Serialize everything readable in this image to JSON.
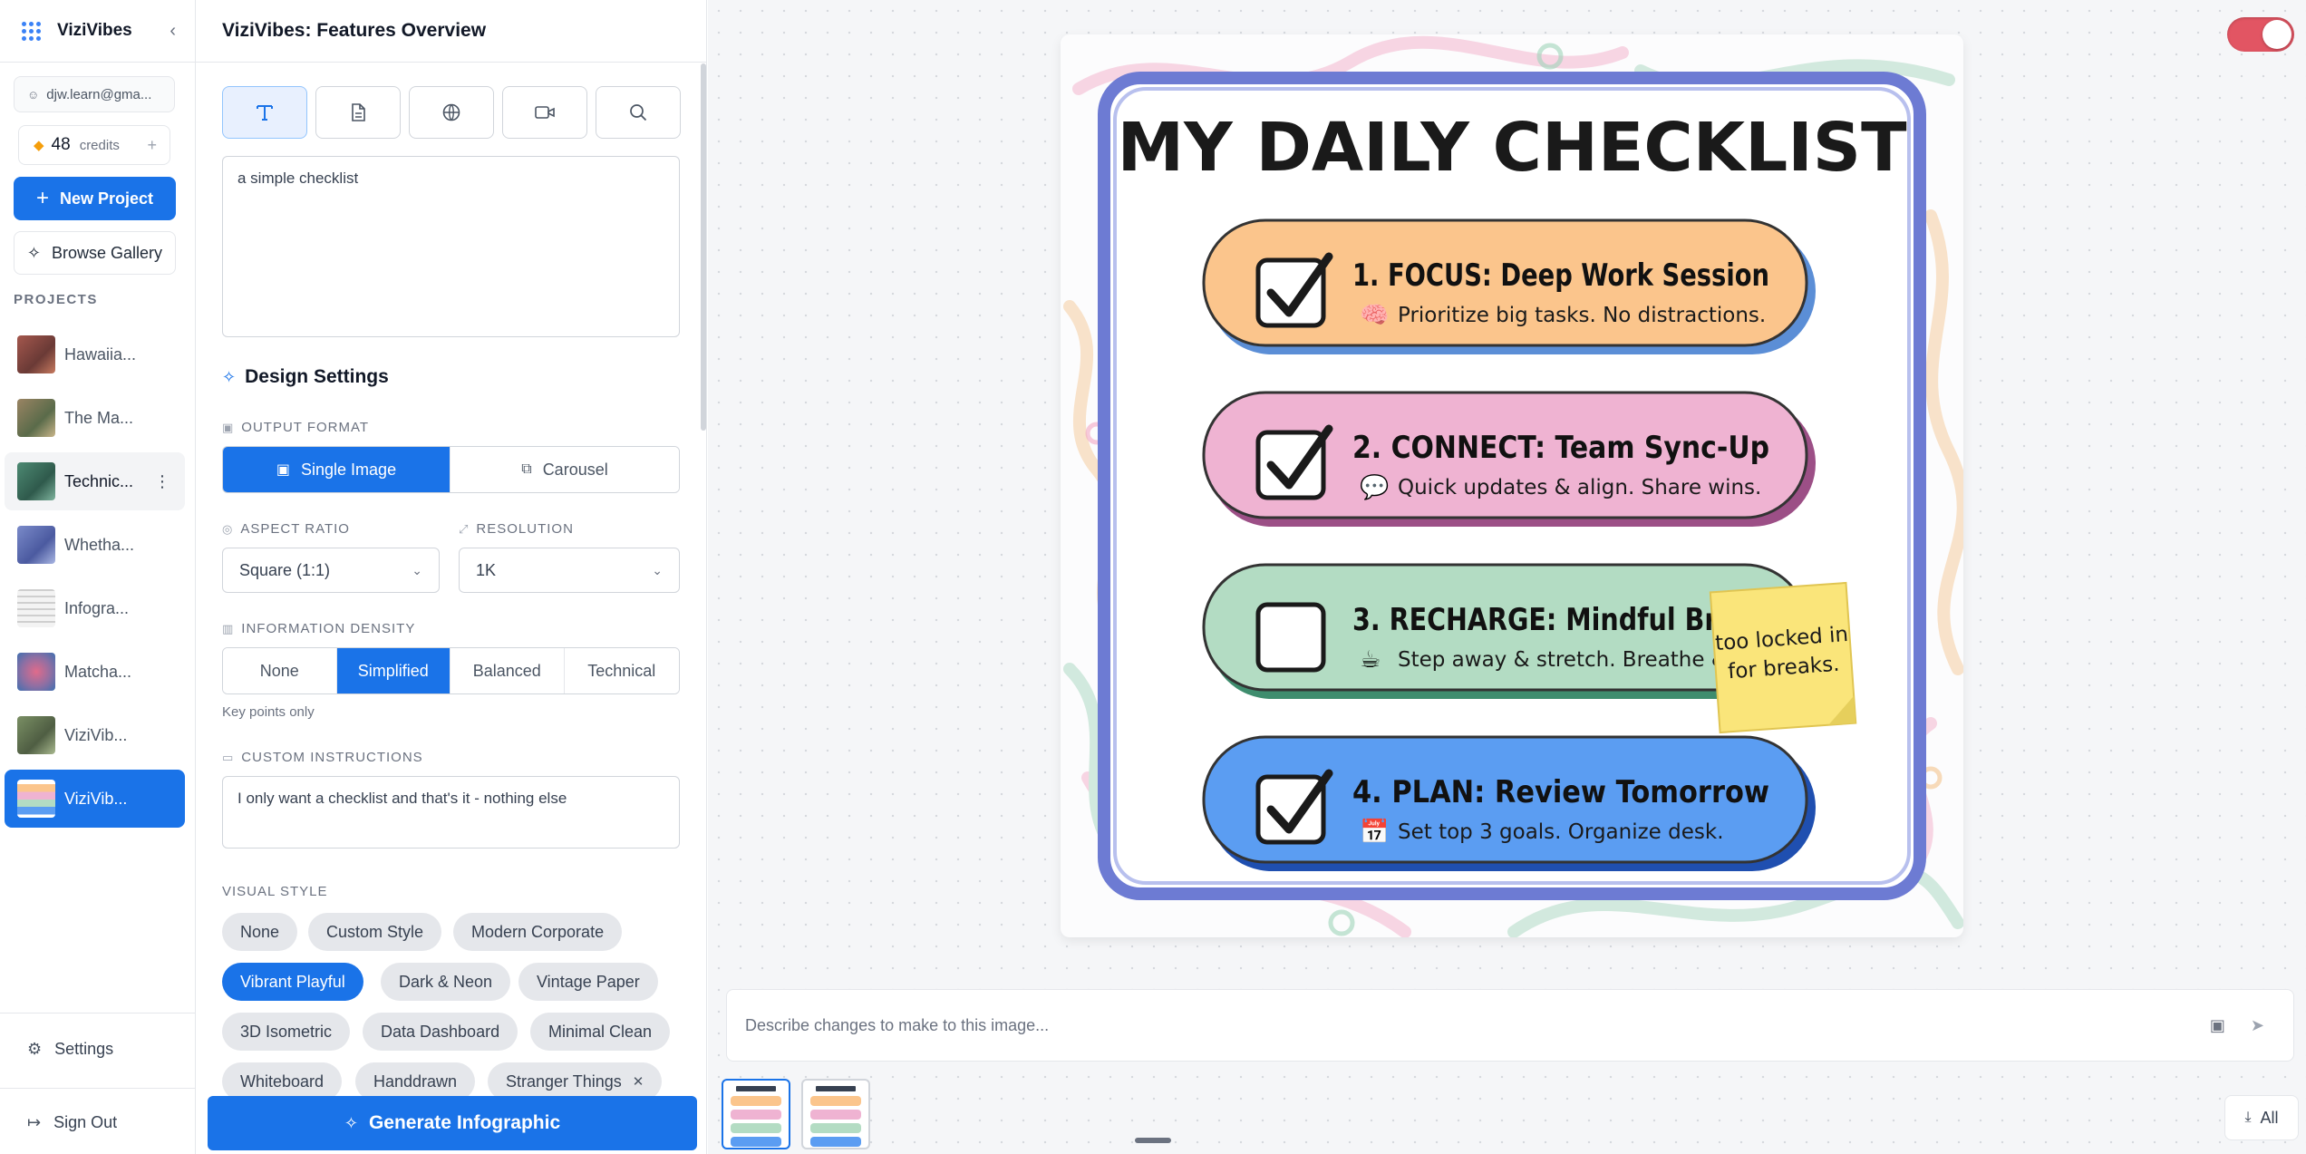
{
  "app": {
    "name": "ViziVibes"
  },
  "user": {
    "email": "djw.learn@gma...",
    "credits": "48",
    "credits_label": "credits"
  },
  "nav": {
    "new_project": "New Project",
    "browse_gallery": "Browse Gallery",
    "projects_heading": "PROJECTS",
    "projects": [
      {
        "label": "Hawaiia...",
        "thumb_color": "#a4574d"
      },
      {
        "label": "The Ma...",
        "thumb_color": "#9a8463"
      },
      {
        "label": "Technic...",
        "thumb_color": "#4d8a73"
      },
      {
        "label": "Whetha...",
        "thumb_color": "#7a8ac9"
      },
      {
        "label": "Infogra...",
        "thumb_color": "#dcdcdc"
      },
      {
        "label": "Matcha...",
        "thumb_color": "#8e6fa3"
      },
      {
        "label": "ViziVib...",
        "thumb_color": "#7a8f64"
      },
      {
        "label": "ViziVib...",
        "thumb_color": "#e9a66b"
      }
    ],
    "settings": "Settings",
    "sign_out": "Sign Out"
  },
  "panel": {
    "title": "ViziVibes: Features Overview",
    "source_tabs": [
      "text-icon",
      "document-icon",
      "globe-icon",
      "video-icon",
      "search-icon"
    ],
    "prompt": "a simple checklist",
    "design_settings": "Design Settings",
    "output_format": {
      "label": "OUTPUT FORMAT",
      "options": [
        "Single Image",
        "Carousel"
      ],
      "selected": "Single Image"
    },
    "aspect_ratio": {
      "label": "ASPECT RATIO",
      "value": "Square (1:1)"
    },
    "resolution": {
      "label": "RESOLUTION",
      "value": "1K"
    },
    "information_density": {
      "label": "INFORMATION DENSITY",
      "options": [
        "None",
        "Simplified",
        "Balanced",
        "Technical"
      ],
      "selected": "Simplified",
      "hint": "Key points only"
    },
    "custom_instructions": {
      "label": "CUSTOM INSTRUCTIONS",
      "value": "I only want a checklist and that's it - nothing else"
    },
    "visual_style": {
      "label": "VISUAL STYLE",
      "chips": [
        "None",
        "Custom Style",
        "Modern Corporate",
        "Vibrant Playful",
        "Dark & Neon",
        "Vintage Paper",
        "3D Isometric",
        "Data Dashboard",
        "Minimal Clean",
        "Whiteboard",
        "Handdrawn",
        "Stranger Things"
      ],
      "selected": "Vibrant Playful"
    },
    "generate": "Generate Infographic"
  },
  "infographic": {
    "title": "MY DAILY CHECKLIST",
    "items": [
      {
        "heading": "1. FOCUS: Deep Work Session",
        "sub": "Prioritize big tasks. No distractions.",
        "checked": true,
        "color": "#fbc58c",
        "icon": "brain-icon"
      },
      {
        "heading": "2. CONNECT: Team Sync-Up",
        "sub": "Quick updates & align. Share wins.",
        "checked": true,
        "color": "#efb3d2",
        "icon": "chat-icon"
      },
      {
        "heading": "3. RECHARGE: Mindful Break",
        "sub": "Step away & stretch. Breathe & reset.",
        "checked": false,
        "color": "#b3dcc3",
        "icon": "tea-cup-icon"
      },
      {
        "heading": "4. PLAN: Review Tomorrow",
        "sub": "Set top 3 goals. Organize desk.",
        "checked": true,
        "color": "#5b9df2",
        "icon": "calendar-icon"
      }
    ],
    "sticky_note": "too locked in\nfor breaks."
  },
  "editor": {
    "placeholder": "Describe changes to make to this image...",
    "download_all": "All"
  }
}
